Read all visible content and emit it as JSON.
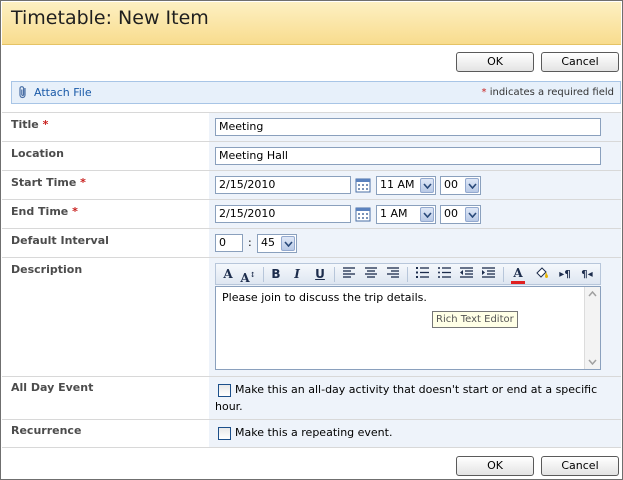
{
  "window": {
    "title": "Timetable: New Item"
  },
  "buttons": {
    "ok": "OK",
    "cancel": "Cancel"
  },
  "attach": {
    "label": "Attach File",
    "required_star": "*",
    "required_note": "indicates a required field"
  },
  "fields": {
    "title": {
      "label": "Title",
      "star": "*",
      "value": "Meeting"
    },
    "location": {
      "label": "Location",
      "value": "Meeting Hall"
    },
    "start_time": {
      "label": "Start Time",
      "star": "*",
      "date": "2/15/2010",
      "hour": "11 AM",
      "minute": "00"
    },
    "end_time": {
      "label": "End Time",
      "star": "*",
      "date": "2/15/2010",
      "hour": "1 AM",
      "minute": "00"
    },
    "default_interval": {
      "label": "Default Interval",
      "hours": "0",
      "separator": ":",
      "minutes": "45"
    },
    "description": {
      "label": "Description",
      "text": "Please join to discuss the trip details.",
      "tooltip": "Rich Text Editor"
    },
    "all_day": {
      "label": "All Day Event",
      "line1": "Make this an all-day activity that doesn't start or end at a specific",
      "line2": "hour."
    },
    "recurrence": {
      "label": "Recurrence",
      "text": "Make this a repeating event."
    }
  },
  "toolbar": {
    "font": "A",
    "font_size": "A",
    "bold": "B",
    "italic": "I",
    "underline": "U"
  },
  "colors": {
    "title_bar": "#fbe6a1",
    "value_bg": "#eef3fa",
    "link": "#1a5aa8",
    "required": "#c8201e"
  }
}
